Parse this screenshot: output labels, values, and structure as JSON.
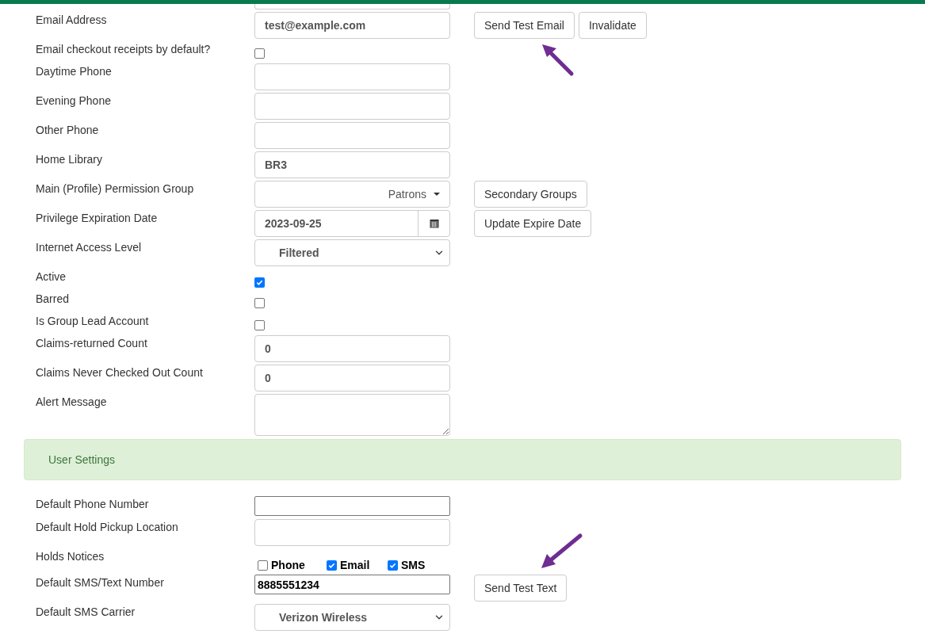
{
  "form_rows": [
    {
      "kind": "text",
      "label": "Email Address",
      "value": "test@example.com",
      "buttons": [
        "Send Test Email",
        "Invalidate"
      ]
    },
    {
      "kind": "checkbox",
      "label": "Email checkout receipts by default?",
      "checked": false
    },
    {
      "kind": "text",
      "label": "Daytime Phone",
      "value": ""
    },
    {
      "kind": "text",
      "label": "Evening Phone",
      "value": ""
    },
    {
      "kind": "text",
      "label": "Other Phone",
      "value": ""
    },
    {
      "kind": "text",
      "label": "Home Library",
      "value": "BR3"
    },
    {
      "kind": "dropdown",
      "label": "Main (Profile) Permission Group",
      "value": "Patrons",
      "buttons": [
        "Secondary Groups"
      ]
    },
    {
      "kind": "date",
      "label": "Privilege Expiration Date",
      "value": "2023-09-25",
      "buttons": [
        "Update Expire Date"
      ]
    },
    {
      "kind": "select",
      "label": "Internet Access Level",
      "value": "Filtered"
    },
    {
      "kind": "checkbox",
      "label": "Active",
      "checked": true
    },
    {
      "kind": "checkbox",
      "label": "Barred",
      "checked": false
    },
    {
      "kind": "checkbox",
      "label": "Is Group Lead Account",
      "checked": false
    },
    {
      "kind": "text",
      "label": "Claims-returned Count",
      "value": "0"
    },
    {
      "kind": "text",
      "label": "Claims Never Checked Out Count",
      "value": "0"
    },
    {
      "kind": "textarea",
      "label": "Alert Message",
      "value": ""
    }
  ],
  "panel": {
    "title": "User Settings"
  },
  "settings_rows": [
    {
      "kind": "plain",
      "label": "Default Phone Number",
      "value": ""
    },
    {
      "kind": "text",
      "label": "Default Hold Pickup Location",
      "value": ""
    },
    {
      "kind": "checkgroup",
      "label": "Holds Notices",
      "options": [
        {
          "label": "Phone",
          "checked": false
        },
        {
          "label": "Email",
          "checked": true
        },
        {
          "label": "SMS",
          "checked": true
        }
      ]
    },
    {
      "kind": "plain",
      "label": "Default SMS/Text Number",
      "value": "8885551234",
      "buttons": [
        "Send Test Text"
      ]
    },
    {
      "kind": "select",
      "label": "Default SMS Carrier",
      "value": "Verizon Wireless"
    }
  ]
}
